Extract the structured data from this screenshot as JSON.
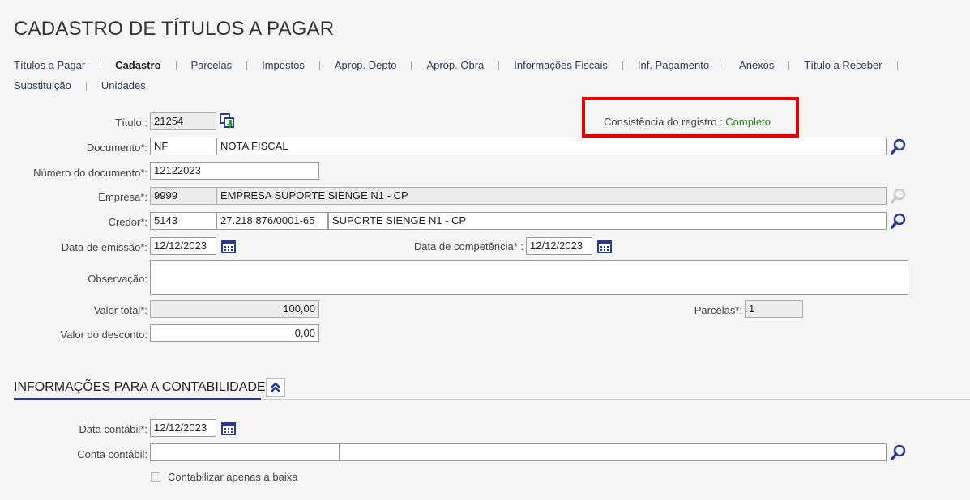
{
  "page_title": "CADASTRO DE TÍTULOS A PAGAR",
  "tabs": [
    {
      "label": "Títulos a Pagar",
      "active": false
    },
    {
      "label": "Cadastro",
      "active": true
    },
    {
      "label": "Parcelas",
      "active": false
    },
    {
      "label": "Impostos",
      "active": false
    },
    {
      "label": "Aprop. Depto",
      "active": false
    },
    {
      "label": "Aprop. Obra",
      "active": false
    },
    {
      "label": "Informações Fiscais",
      "active": false
    },
    {
      "label": "Inf. Pagamento",
      "active": false
    },
    {
      "label": "Anexos",
      "active": false
    },
    {
      "label": "Título a Receber",
      "active": false
    },
    {
      "label": "Substituição",
      "active": false
    },
    {
      "label": "Unidades",
      "active": false
    }
  ],
  "form": {
    "titulo_label": "Título :",
    "titulo_value": "21254",
    "consistencia_label": "Consistência do registro : ",
    "consistencia_value": "Completo",
    "documento_label": "Documento*:",
    "documento_code": "NF",
    "documento_desc": "NOTA FISCAL",
    "numero_label": "Número do documento*:",
    "numero_value": "12122023",
    "empresa_label": "Empresa*:",
    "empresa_code": "9999",
    "empresa_name": "EMPRESA SUPORTE SIENGE N1 - CP",
    "credor_label": "Credor*:",
    "credor_code": "5143",
    "credor_cnpj": "27.218.876/0001-65",
    "credor_name": "SUPORTE SIENGE N1 - CP",
    "emissao_label": "Data de emissão*:",
    "emissao_value": "12/12/2023",
    "competencia_label": "Data de competência* :",
    "competencia_value": "12/12/2023",
    "observacao_label": "Observação:",
    "observacao_value": "",
    "valor_total_label": "Valor total*:",
    "valor_total_value": "100,00",
    "parcelas_label": "Parcelas*:",
    "parcelas_value": "1",
    "desconto_label": "Valor do desconto:",
    "desconto_value": "0,00"
  },
  "contabilidade": {
    "section_title": "INFORMAÇÕES PARA A CONTABILIDADE",
    "data_contabil_label": "Data contábil*:",
    "data_contabil_value": "12/12/2023",
    "conta_contabil_label": "Conta contábil:",
    "conta_code": "",
    "conta_desc": "",
    "checkbox_label": "Contabilizar apenas a baixa"
  },
  "colors": {
    "accent": "#2b3a8a",
    "highlight_border": "#e60000",
    "status_ok": "#2e7d1e"
  }
}
